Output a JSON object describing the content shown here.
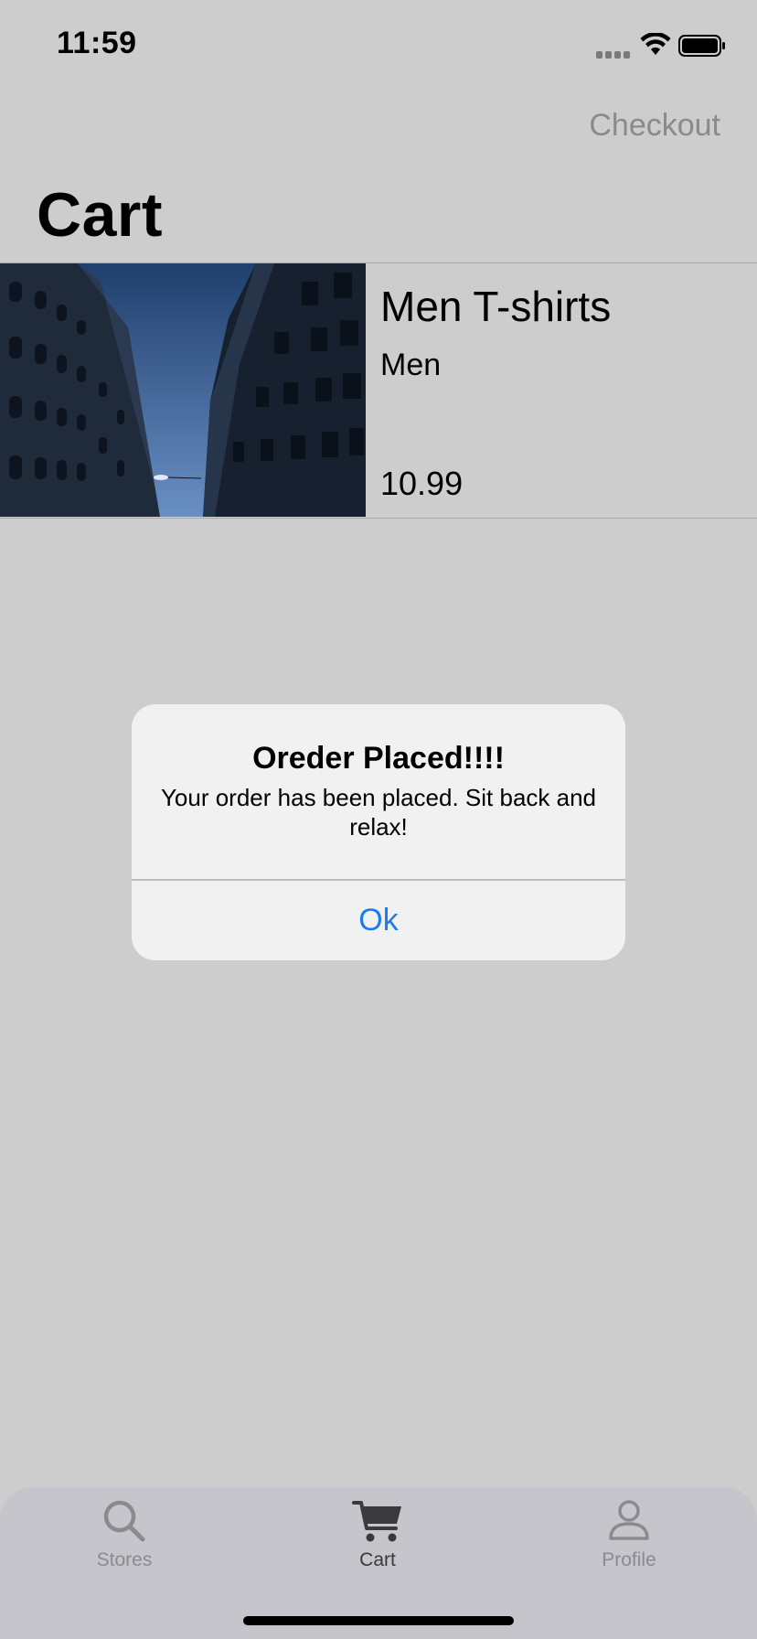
{
  "status_bar": {
    "time": "11:59"
  },
  "nav": {
    "checkout_label": "Checkout",
    "title": "Cart"
  },
  "cart": {
    "items": [
      {
        "name": "Men T-shirts",
        "category": "Men",
        "price": "10.99",
        "image": "city-buildings-photo"
      }
    ]
  },
  "alert": {
    "title": "Oreder Placed!!!!",
    "message": "Your order has been placed. Sit back and relax!",
    "ok_label": "Ok"
  },
  "tab_bar": {
    "tabs": [
      {
        "label": "Stores",
        "icon": "search-icon",
        "active": false
      },
      {
        "label": "Cart",
        "icon": "cart-icon",
        "active": true
      },
      {
        "label": "Profile",
        "icon": "person-icon",
        "active": false
      }
    ]
  },
  "colors": {
    "background": "#cdcdcd",
    "accent": "#1a7cf0",
    "alert_bg": "#f1f1f1",
    "tab_bar_bg": "#c5c5cb",
    "inactive": "#8b8b8f"
  }
}
